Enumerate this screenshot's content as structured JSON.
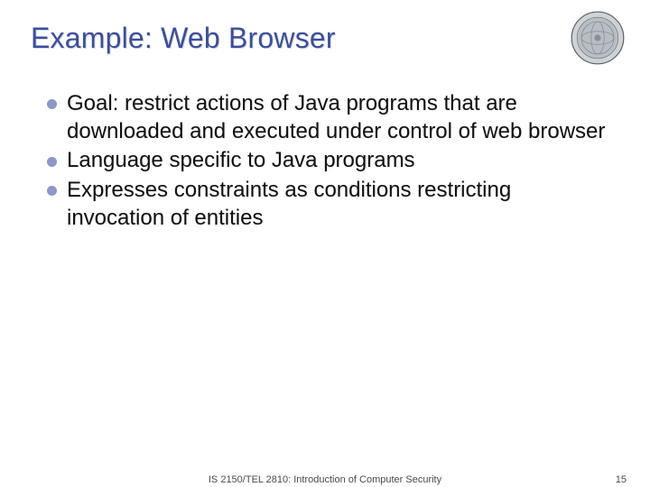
{
  "title": "Example: Web Browser",
  "bullets": [
    "Goal: restrict actions of Java programs that are downloaded and executed under control of web browser",
    "Language specific to Java programs",
    "Expresses constraints as conditions restricting invocation of entities"
  ],
  "footer": {
    "course": "IS 2150/TEL 2810: Introduction of Computer Security",
    "page": "15"
  }
}
